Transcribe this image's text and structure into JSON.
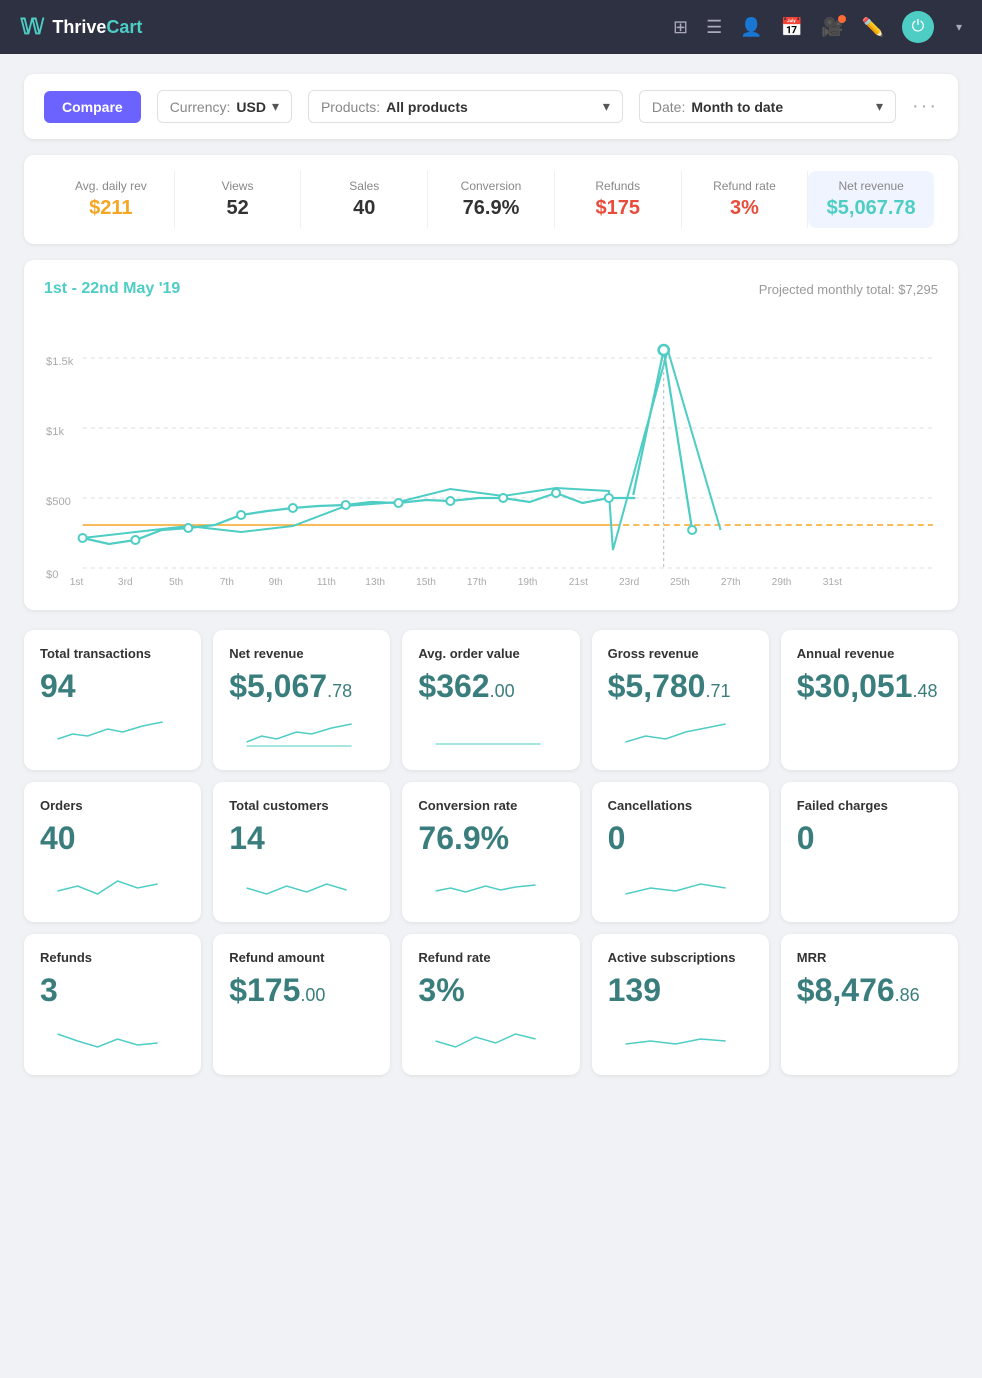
{
  "header": {
    "logo_thrive": "Thrive",
    "logo_cart": "Cart",
    "icons": [
      "grid-icon",
      "list-icon",
      "user-icon",
      "calendar-icon",
      "video-icon",
      "edit-icon"
    ],
    "power_button": "⏻",
    "chevron": "▾"
  },
  "toolbar": {
    "compare_label": "Compare",
    "currency_label": "Currency:",
    "currency_value": "USD",
    "products_label": "Products:",
    "products_value": "All products",
    "date_label": "Date:",
    "date_value": "Month to date"
  },
  "stats": [
    {
      "label": "Avg. daily rev",
      "value": "$211",
      "color": "orange"
    },
    {
      "label": "Views",
      "value": "52",
      "color": "normal"
    },
    {
      "label": "Sales",
      "value": "40",
      "color": "normal"
    },
    {
      "label": "Conversion",
      "value": "76.9%",
      "color": "normal"
    },
    {
      "label": "Refunds",
      "value": "$175",
      "color": "red"
    },
    {
      "label": "Refund rate",
      "value": "3%",
      "color": "red"
    },
    {
      "label": "Net revenue",
      "value": "$5,067.78",
      "color": "teal"
    }
  ],
  "chart": {
    "title": "1st - 22nd May '19",
    "projected": "Projected monthly total: $7,295",
    "x_labels": [
      "1st",
      "3rd",
      "5th",
      "7th",
      "9th",
      "11th",
      "13th",
      "15th",
      "17th",
      "19th",
      "21st",
      "23rd",
      "25th",
      "27th",
      "29th",
      "31st"
    ],
    "y_labels": [
      "$0",
      "$500",
      "$1k",
      "$1.5k"
    ]
  },
  "metrics_row1": [
    {
      "label": "Total transactions",
      "value": "94",
      "prefix": "",
      "suffix": "",
      "small": ""
    },
    {
      "label": "Net revenue",
      "value": "$5,067",
      "prefix": "",
      "suffix": "",
      "small": ".78"
    },
    {
      "label": "Avg. order value",
      "value": "$362",
      "prefix": "",
      "suffix": "",
      "small": ".00"
    },
    {
      "label": "Gross revenue",
      "value": "$5,780",
      "prefix": "",
      "suffix": "",
      "small": ".71"
    },
    {
      "label": "Annual revenue",
      "value": "$30,051",
      "prefix": "",
      "suffix": "",
      "small": ".48"
    }
  ],
  "metrics_row2": [
    {
      "label": "Orders",
      "value": "40",
      "prefix": "",
      "suffix": "",
      "small": ""
    },
    {
      "label": "Total customers",
      "value": "14",
      "prefix": "",
      "suffix": "",
      "small": ""
    },
    {
      "label": "Conversion rate",
      "value": "76.9%",
      "prefix": "",
      "suffix": "",
      "small": ""
    },
    {
      "label": "Cancellations",
      "value": "0",
      "prefix": "",
      "suffix": "",
      "small": ""
    },
    {
      "label": "Failed charges",
      "value": "0",
      "prefix": "",
      "suffix": "",
      "small": ""
    }
  ],
  "metrics_row3": [
    {
      "label": "Refunds",
      "value": "3",
      "prefix": "",
      "suffix": "",
      "small": ""
    },
    {
      "label": "Refund amount",
      "value": "$175",
      "prefix": "",
      "suffix": "",
      "small": ".00"
    },
    {
      "label": "Refund rate",
      "value": "3%",
      "prefix": "",
      "suffix": "",
      "small": ""
    },
    {
      "label": "Active subscriptions",
      "value": "139",
      "prefix": "",
      "suffix": "",
      "small": ""
    },
    {
      "label": "MRR",
      "value": "$8,476",
      "prefix": "",
      "suffix": "",
      "small": ".86"
    }
  ]
}
